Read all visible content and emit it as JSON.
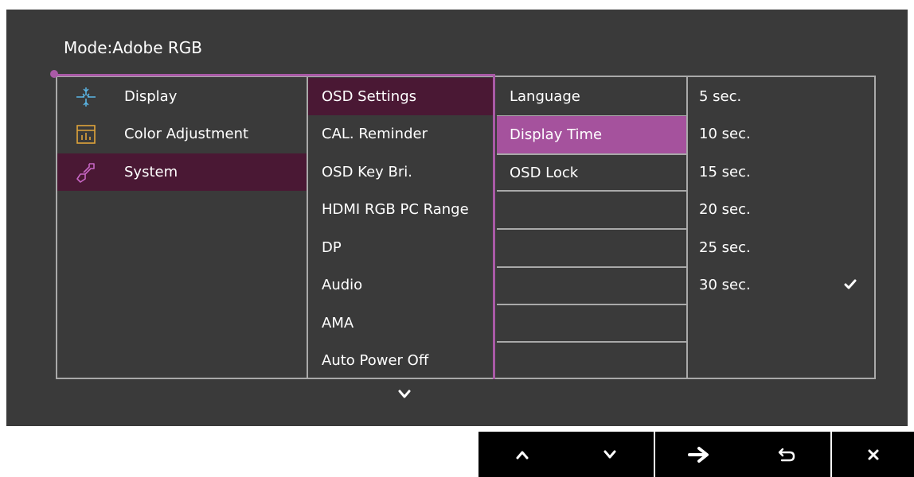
{
  "mode": {
    "label": "Mode:",
    "value": "Adobe RGB"
  },
  "main_menu": [
    {
      "label": "Display",
      "icon": "display-icon"
    },
    {
      "label": "Color Adjustment",
      "icon": "color-adjustment-icon"
    },
    {
      "label": "System",
      "icon": "system-wrench-icon",
      "selected": true
    }
  ],
  "system_menu": [
    {
      "label": "OSD Settings",
      "selected": true
    },
    {
      "label": "CAL. Reminder"
    },
    {
      "label": "OSD Key Bri."
    },
    {
      "label": "HDMI RGB PC Range"
    },
    {
      "label": "DP"
    },
    {
      "label": "Audio"
    },
    {
      "label": "AMA"
    },
    {
      "label": "Auto Power Off"
    }
  ],
  "osd_settings_menu": [
    {
      "label": "Language"
    },
    {
      "label": "Display Time",
      "selected": true
    },
    {
      "label": "OSD Lock"
    }
  ],
  "display_time_options": [
    {
      "label": "5 sec."
    },
    {
      "label": "10 sec."
    },
    {
      "label": "15 sec."
    },
    {
      "label": "20 sec."
    },
    {
      "label": "25 sec."
    },
    {
      "label": "30 sec.",
      "checked": true
    }
  ],
  "nav_buttons": [
    "up-arrow-icon",
    "down-arrow-icon",
    "right-arrow-icon",
    "back-icon",
    "close-icon"
  ],
  "colors": {
    "accent": "#a95aa6",
    "selected_dark": "#4a1834",
    "selected_bright": "#a5529d",
    "panel": "#3a3a3a",
    "border": "#a9a9a9"
  }
}
